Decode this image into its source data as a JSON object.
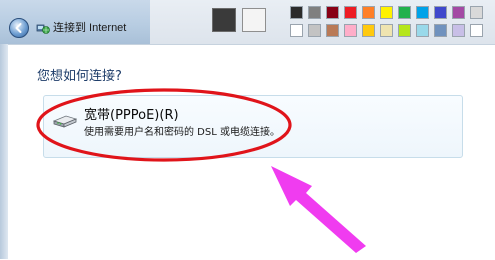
{
  "window": {
    "title": "连接到 Internet"
  },
  "main": {
    "prompt": "您想如何连接?",
    "options": [
      {
        "title": "宽带(PPPoE)(R)",
        "description": "使用需要用户名和密码的 DSL 或电缆连接。",
        "icon": "modem-icon"
      }
    ]
  },
  "annotations": {
    "highlight_color": "#e0141a",
    "arrow_color": "#f03cf0"
  },
  "palette_colors": [
    "#2b2b2b",
    "#7f7f7f",
    "#880015",
    "#ed1c24",
    "#ff7f27",
    "#fff200",
    "#22b14c",
    "#00a2e8",
    "#3f48cc",
    "#a349a4",
    "#ffffff",
    "#c3c3c3",
    "#b97a57",
    "#ffaec9",
    "#ffc90e",
    "#efe4b0",
    "#b5e61d",
    "#99d9ea",
    "#7092be",
    "#c8bfe7"
  ]
}
